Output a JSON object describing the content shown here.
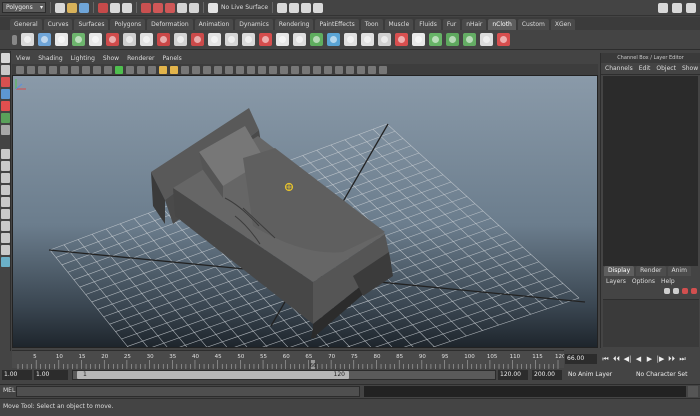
{
  "status_line": {
    "mode_menu": "Polygons",
    "live_surface_label": "No Live Surface"
  },
  "shelf": {
    "tabs": [
      "General",
      "Curves",
      "Surfaces",
      "Polygons",
      "Deformation",
      "Animation",
      "Dynamics",
      "Rendering",
      "PaintEffects",
      "Toon",
      "Muscle",
      "Fluids",
      "Fur",
      "nHair",
      "nCloth",
      "Custom",
      "XGen"
    ],
    "active_tab": "nCloth",
    "icon_colors": [
      "#d9d9d9",
      "#6fa5d8",
      "#e8e8e8",
      "#6db56d",
      "#e7e7e7",
      "#d04b4b",
      "#cfcfcf",
      "#e0e0e0",
      "#cb4747",
      "#d2d2d2",
      "#cc4a4a",
      "#e3e3e3",
      "#d4d4d4",
      "#d9d9d9",
      "#d54d4d",
      "#e6e6e6",
      "#dddddd",
      "#5fae5f",
      "#5aa4d4",
      "#e0e0e0",
      "#e0e0e0",
      "#d0d0d0",
      "#d84f4f",
      "#e8e8e8",
      "#67b467",
      "#5ea85e",
      "#64ad64",
      "#dcdcdc",
      "#d74e4e"
    ]
  },
  "panel": {
    "menus": [
      "View",
      "Shading",
      "Lighting",
      "Show",
      "Renderer",
      "Panels"
    ]
  },
  "channel_box": {
    "title": "Channel Box / Layer Editor",
    "menus": [
      "Channels",
      "Edit",
      "Object",
      "Show"
    ]
  },
  "layer_editor": {
    "tabs": [
      "Display",
      "Render",
      "Anim"
    ],
    "active_tab": "Display",
    "menus": [
      "Layers",
      "Options",
      "Help"
    ]
  },
  "time_slider": {
    "start": 1,
    "end": 120,
    "major_ticks": [
      5,
      10,
      15,
      20,
      25,
      30,
      35,
      40,
      45,
      50,
      55,
      60,
      65,
      70,
      75,
      80,
      85,
      90,
      95,
      100,
      105,
      110,
      115,
      120
    ],
    "current_time": 66,
    "current_frame_field": "66.00"
  },
  "playback": {
    "buttons": [
      "⏮",
      "⏴⏴",
      "◀|",
      "◀",
      "▶",
      "|▶",
      "⏵⏵",
      "⏭"
    ]
  },
  "range_slider": {
    "start_time": "1.00",
    "playback_start": "1.00",
    "range_start_label": "1",
    "range_end_label": "120",
    "playback_end": "120.00",
    "end_time": "200.00",
    "anim_layer": "No Anim Layer",
    "character_set": "No Character Set"
  },
  "command_line": {
    "label": "MEL"
  },
  "help_line": {
    "text": "Move Tool: Select an object to move."
  }
}
